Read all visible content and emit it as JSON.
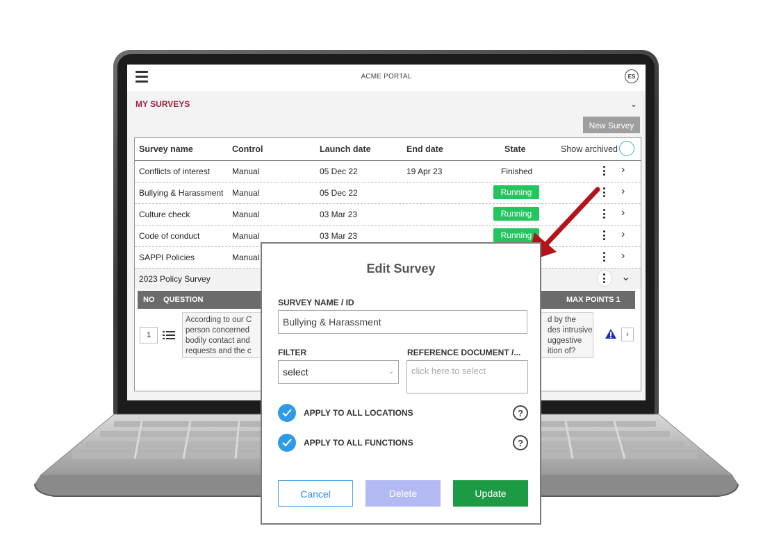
{
  "app": {
    "title": "ACME PORTAL",
    "avatar_initials": "ES"
  },
  "section": {
    "title": "MY SURVEYS"
  },
  "toolbar": {
    "new_survey_label": "New Survey"
  },
  "table": {
    "columns": [
      "Survey name",
      "Control",
      "Launch date",
      "End date",
      "State",
      "Show archived"
    ],
    "rows": [
      {
        "name": "Conflicts of interest",
        "control": "Manual",
        "launch": "05 Dec 22",
        "end": "19 Apr 23",
        "state": "Finished"
      },
      {
        "name": "Bullying & Harassment",
        "control": "Manual",
        "launch": "05 Dec 22",
        "end": "",
        "state": "Running"
      },
      {
        "name": "Culture check",
        "control": "Manual",
        "launch": "03 Mar 23",
        "end": "",
        "state": "Running"
      },
      {
        "name": "Code of conduct",
        "control": "Manual",
        "launch": "03 Mar 23",
        "end": "",
        "state": "Running"
      },
      {
        "name": "SAPPI Policies",
        "control": "Manual",
        "launch": "",
        "end": "",
        "state": ""
      },
      {
        "name": "2023 Policy Survey",
        "control": "",
        "launch": "",
        "end": "",
        "state": ""
      }
    ]
  },
  "questions": {
    "header_no": "NO",
    "header_question": "QUESTION",
    "header_points": "MAX POINTS 1",
    "number": "1",
    "text_left": "According to our C\nperson concerned\nbodily contact and\nrequests and the c",
    "text_right": "d by the\ndes intrusive\nuggestive\nition of?"
  },
  "modal": {
    "title": "Edit Survey",
    "name_label": "SURVEY NAME / ID",
    "name_value": "Bullying & Harassment",
    "filter_label": "FILTER",
    "filter_value": "select",
    "reference_label": "REFERENCE DOCUMENT /...",
    "reference_placeholder": "click here to select",
    "apply_locations_label": "APPLY TO ALL LOCATIONS",
    "apply_functions_label": "APPLY TO ALL FUNCTIONS",
    "cancel_label": "Cancel",
    "delete_label": "Delete",
    "update_label": "Update"
  },
  "colors": {
    "accent": "#9c2242",
    "running": "#22c55e",
    "primary": "#2f9be8",
    "update": "#1d9b44",
    "delete_disabled": "#b3b9f2",
    "arrow": "#b3141b"
  }
}
